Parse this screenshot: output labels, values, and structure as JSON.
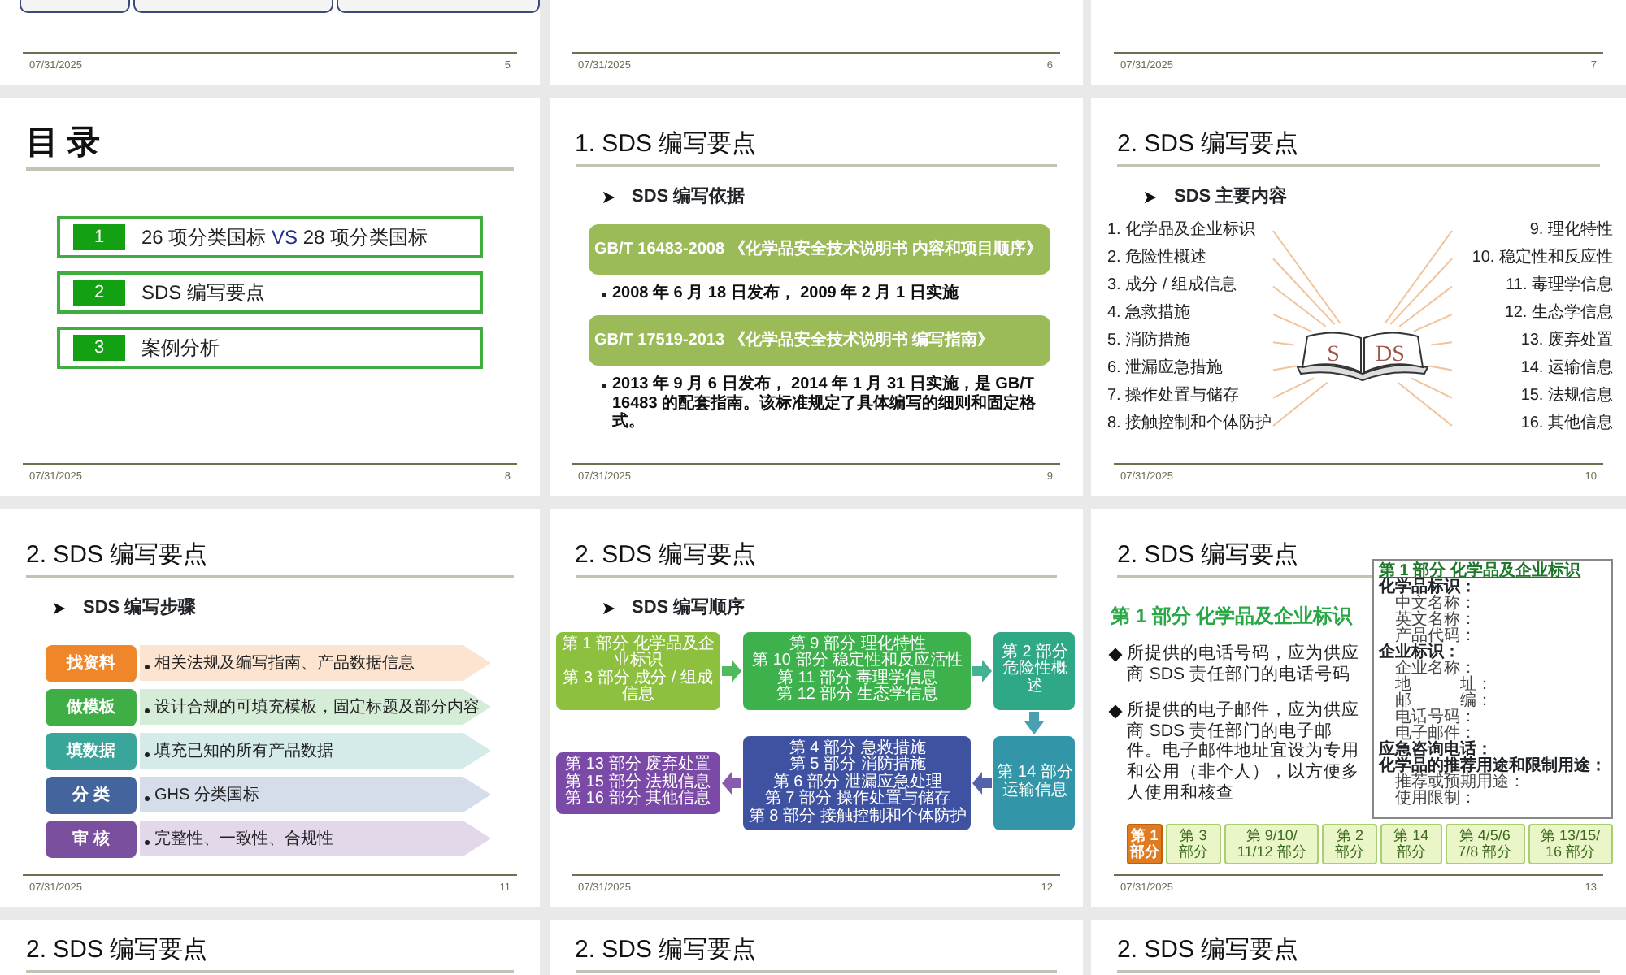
{
  "slides": [
    {
      "kind": "cut_boxes",
      "date": "07/31/2025",
      "number": "5"
    },
    {
      "kind": "blank",
      "date": "07/31/2025",
      "number": "6"
    },
    {
      "kind": "blank",
      "date": "07/31/2025",
      "number": "7"
    },
    {
      "kind": "toc",
      "title": "目 录",
      "date": "07/31/2025",
      "number": "8",
      "items": [
        {
          "number": "1",
          "text_before": "26 项分类国标",
          "emphasis": "VS",
          "text_after": "28 项分类国标"
        },
        {
          "number": "2",
          "text_before": "SDS 编写要点"
        },
        {
          "number": "3",
          "text_before": "案例分析"
        }
      ]
    },
    {
      "kind": "standards",
      "title": "1. SDS 编写要点",
      "subtitle": "SDS 编写依据",
      "date": "07/31/2025",
      "number": "9",
      "blocks": [
        {
          "standard": "GB/T 16483-2008 《化学品安全技术说明书  内容和项目顺序》",
          "note": "2008 年 6 月 18 日发布， 2009 年 2 月 1 日实施"
        },
        {
          "standard": "GB/T 17519-2013  《化学品安全技术说明书  编写指南》",
          "note": "2013 年 9 月 6 日发布， 2014 年 1 月 31 日实施，是 GB/T 16483 的配套指南。该标准规定了具体编写的细则和固定格式。"
        }
      ]
    },
    {
      "kind": "book",
      "title": "2. SDS 编写要点",
      "subtitle": "SDS 主要内容",
      "date": "07/31/2025",
      "number": "10",
      "book_left": "S",
      "book_right": "DS",
      "left_labels": [
        "1. 化学品及企业标识",
        "2. 危险性概述",
        "3. 成分 / 组成信息",
        "4.  急救措施",
        "5.  消防措施",
        "6.  泄漏应急措施",
        "7.  操作处置与储存",
        "8.  接触控制和个体防护"
      ],
      "right_labels": [
        "9.  理化特性",
        "10.  稳定性和反应性",
        "11.  毒理学信息",
        "12.  生态学信息",
        "13.  废弃处置",
        "14.  运输信息",
        "15.  法规信息",
        "16.  其他信息"
      ]
    },
    {
      "kind": "steps",
      "title": "2. SDS 编写要点",
      "subtitle": "SDS 编写步骤",
      "date": "07/31/2025",
      "number": "11",
      "steps": [
        {
          "label": "找资料",
          "text": "相关法规及编写指南、产品数据信息",
          "color": "#f0862a"
        },
        {
          "label": "做模板",
          "text": "设计合规的可填充模板，固定标题及部分内容",
          "color": "#3fae45"
        },
        {
          "label": "填数据",
          "text": "填充已知的所有产品数据",
          "color": "#3aa59a"
        },
        {
          "label": "分 类",
          "text": "GHS 分类国标",
          "color": "#44649e"
        },
        {
          "label": "审 核",
          "text": "完整性、一致性、合规性",
          "color": "#7a4f9e"
        }
      ]
    },
    {
      "kind": "flow",
      "title": "2. SDS 编写要点",
      "subtitle": "SDS 编写顺序",
      "date": "07/31/2025",
      "number": "12",
      "boxes": [
        {
          "lines": [
            "第 1 部分  化学品及企业标识",
            "第 3 部分  成分 / 组成信息"
          ],
          "color": "#8cc03e"
        },
        {
          "lines": [
            "第 9 部分  理化特性",
            "第 10 部分  稳定性和反应活性",
            "第 11 部分  毒理学信息",
            "第 12 部分  生态学信息"
          ],
          "color": "#3db24c"
        },
        {
          "lines": [
            "第 2 部分",
            "危险性概述"
          ],
          "color": "#2ea886"
        },
        {
          "lines": [
            "第 13 部分  废弃处置",
            "第 15 部分  法规信息",
            "第 16 部分  其他信息"
          ],
          "color": "#7a4aa6"
        },
        {
          "lines": [
            "第 4 部分  急救措施",
            "第 5 部分  消防措施",
            "第 6 部分  泄漏应急处理",
            "第 7 部分  操作处置与储存",
            "第 8 部分  接触控制和个体防护"
          ],
          "color": "#3f52a2"
        },
        {
          "lines": [
            "第 14 部分",
            "运输信息"
          ],
          "color": "#3396a8"
        }
      ]
    },
    {
      "kind": "part1",
      "title": "2. SDS 编写要点",
      "heading": "第 1 部分  化学品及企业标识",
      "date": "07/31/2025",
      "number": "13",
      "bullets": [
        "所提供的电话号码，应为供应商 SDS 责任部门的电话号码",
        "所提供的电子邮件，应为供应商 SDS 责任部门的电子邮件。电子邮件地址宜设为专用和公用（非个人），以方便多人使用和核查"
      ],
      "form_title": "第 1 部分   化学品及企业标识",
      "form_rows": [
        {
          "kind": "section",
          "text": "化学品标识："
        },
        {
          "kind": "field",
          "text": "中文名称："
        },
        {
          "kind": "field",
          "text": "英文名称："
        },
        {
          "kind": "field",
          "text": "产品代码："
        },
        {
          "kind": "section",
          "text": "企业标识："
        },
        {
          "kind": "field",
          "text": "企业名称："
        },
        {
          "kind": "field",
          "text": "地　　　址："
        },
        {
          "kind": "field",
          "text": "邮　　　编："
        },
        {
          "kind": "field",
          "text": "电话号码："
        },
        {
          "kind": "field",
          "text": "电子邮件："
        },
        {
          "kind": "section",
          "text": "应急咨询电话："
        },
        {
          "kind": "section",
          "text": "化学品的推荐用途和限制用途："
        },
        {
          "kind": "field",
          "text": "推荐或预期用途："
        },
        {
          "kind": "field",
          "text": "使用限制："
        }
      ],
      "chain": [
        {
          "lines": [
            "第 1",
            "部分"
          ],
          "selected": true
        },
        {
          "lines": [
            "第 3",
            "部分"
          ],
          "selected": false
        },
        {
          "lines": [
            "第 9/10/",
            "11/12 部分"
          ],
          "selected": false
        },
        {
          "lines": [
            "第 2",
            "部分"
          ],
          "selected": false
        },
        {
          "lines": [
            "第 14",
            "部分"
          ],
          "selected": false
        },
        {
          "lines": [
            "第 4/5/6",
            "7/8 部分"
          ],
          "selected": false
        },
        {
          "lines": [
            "第 13/15/",
            "16 部分"
          ],
          "selected": false
        }
      ]
    },
    {
      "kind": "title_only",
      "title": "2. SDS 编写要点"
    },
    {
      "kind": "title_only",
      "title": "2. SDS 编写要点"
    },
    {
      "kind": "title_only",
      "title": "2. SDS 编写要点"
    }
  ]
}
